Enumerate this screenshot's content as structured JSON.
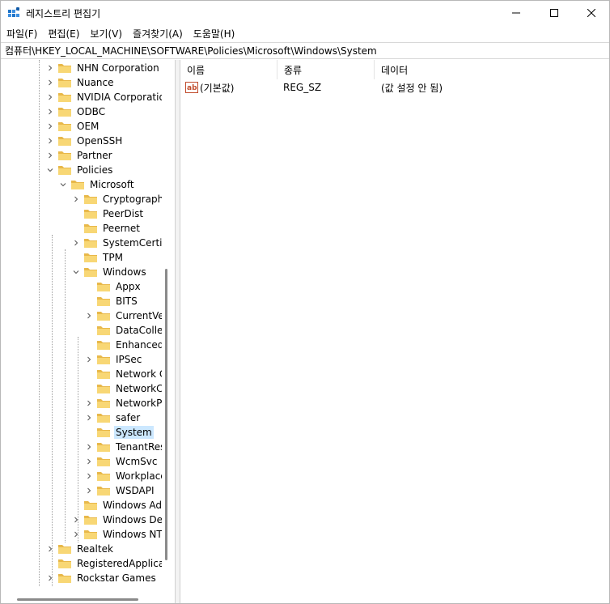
{
  "window": {
    "title": "레지스트리 편집기"
  },
  "menu": {
    "items": [
      {
        "label": "파일(F)"
      },
      {
        "label": "편집(E)"
      },
      {
        "label": "보기(V)"
      },
      {
        "label": "즐겨찾기(A)"
      },
      {
        "label": "도움말(H)"
      }
    ]
  },
  "address": {
    "path": "컴퓨터\\HKEY_LOCAL_MACHINE\\SOFTWARE\\Policies\\Microsoft\\Windows\\System"
  },
  "tree": {
    "items": [
      {
        "label": "NHN Corporation",
        "expander": "collapsed"
      },
      {
        "label": "Nuance",
        "expander": "collapsed"
      },
      {
        "label": "NVIDIA Corporation",
        "expander": "collapsed"
      },
      {
        "label": "ODBC",
        "expander": "collapsed"
      },
      {
        "label": "OEM",
        "expander": "collapsed"
      },
      {
        "label": "OpenSSH",
        "expander": "collapsed"
      },
      {
        "label": "Partner",
        "expander": "collapsed"
      },
      {
        "label": "Policies",
        "expander": "expanded"
      },
      {
        "label": "Microsoft",
        "expander": "expanded"
      },
      {
        "label": "Cryptography",
        "expander": "collapsed"
      },
      {
        "label": "PeerDist",
        "expander": "none"
      },
      {
        "label": "Peernet",
        "expander": "none"
      },
      {
        "label": "SystemCertific",
        "expander": "collapsed"
      },
      {
        "label": "TPM",
        "expander": "none"
      },
      {
        "label": "Windows",
        "expander": "expanded"
      },
      {
        "label": "Appx",
        "expander": "none"
      },
      {
        "label": "BITS",
        "expander": "none"
      },
      {
        "label": "CurrentVers",
        "expander": "collapsed"
      },
      {
        "label": "DataCollect",
        "expander": "none"
      },
      {
        "label": "EnhancedS",
        "expander": "none"
      },
      {
        "label": "IPSec",
        "expander": "collapsed"
      },
      {
        "label": "Network Co",
        "expander": "none"
      },
      {
        "label": "NetworkCo",
        "expander": "none"
      },
      {
        "label": "NetworkPro",
        "expander": "collapsed"
      },
      {
        "label": "safer",
        "expander": "collapsed"
      },
      {
        "label": "System",
        "expander": "none",
        "selected": true
      },
      {
        "label": "TenantRest",
        "expander": "collapsed"
      },
      {
        "label": "WcmSvc",
        "expander": "collapsed"
      },
      {
        "label": "WorkplaceJ",
        "expander": "collapsed"
      },
      {
        "label": "WSDAPI",
        "expander": "collapsed"
      },
      {
        "label": "Windows Adv",
        "expander": "none"
      },
      {
        "label": "Windows Defe",
        "expander": "collapsed"
      },
      {
        "label": "Windows NT",
        "expander": "collapsed"
      },
      {
        "label": "Realtek",
        "expander": "collapsed"
      },
      {
        "label": "RegisteredApplicatio",
        "expander": "none"
      },
      {
        "label": "Rockstar Games",
        "expander": "collapsed"
      }
    ]
  },
  "list": {
    "columns": [
      {
        "label": "이름"
      },
      {
        "label": "종류"
      },
      {
        "label": "데이터"
      }
    ],
    "rows": [
      {
        "name": "(기본값)",
        "type": "REG_SZ",
        "data": "(값 설정 안 됨)"
      }
    ]
  },
  "colors": {
    "selection": "#cce8ff",
    "folder_fill": "#f8d775",
    "folder_tab": "#e8b84a",
    "app_icon": "#1e73c8"
  }
}
